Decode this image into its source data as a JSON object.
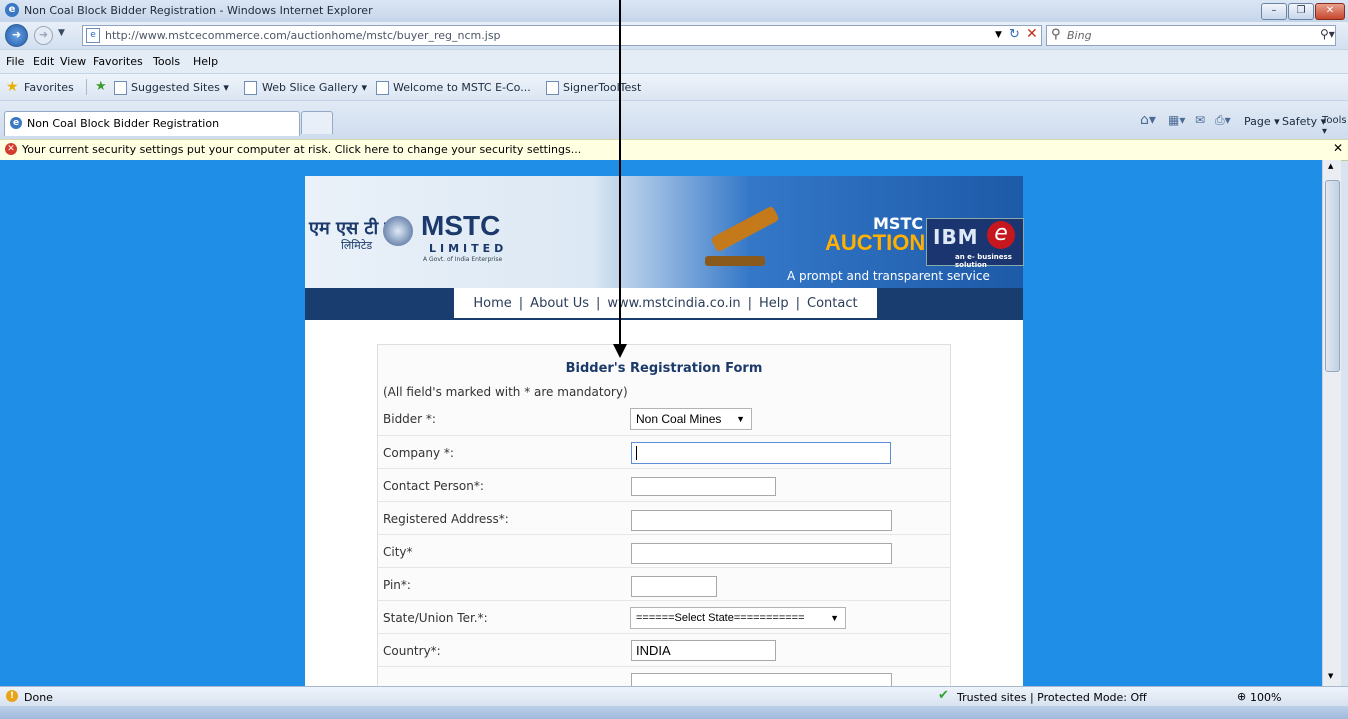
{
  "window": {
    "title": "Non Coal Block Bidder Registration - Windows Internet Explorer"
  },
  "address": {
    "url": "http://www.mstcecommerce.com/auctionhome/mstc/buyer_reg_ncm.jsp",
    "search_placeholder": "Bing"
  },
  "menu": [
    "File",
    "Edit",
    "View",
    "Favorites",
    "Tools",
    "Help"
  ],
  "favorites": {
    "label": "Favorites",
    "items": [
      "Suggested Sites ▾",
      "Web Slice Gallery ▾",
      "Welcome to MSTC E-Co...",
      "SignerToolTest"
    ]
  },
  "tab": {
    "title": "Non Coal Block Bidder Registration"
  },
  "commandbar": [
    "Page ▾",
    "Safety ▾",
    "Tools ▾"
  ],
  "infobar": {
    "text": "Your current security settings put your computer at risk. Click here to change your security settings..."
  },
  "banner": {
    "hindi": "एम एस टी सी",
    "hindi_sub": "लिमिटेड",
    "logo_title": "MSTC",
    "logo_sub": "LIMITED",
    "govt": "A Govt. of India Enterprise",
    "auction_top": "MSTC",
    "auction": "AUCTION",
    "ibm": "IBM",
    "ebiz": "an e- business solution",
    "tagline": "A prompt and transparent service"
  },
  "nav": [
    "Home",
    "About Us",
    "www.mstcindia.co.in",
    "Help",
    "Contact"
  ],
  "form": {
    "title": "Bidder's Registration Form",
    "note": "(All field's marked with * are mandatory)",
    "fields": [
      {
        "label": "Bidder *:",
        "value": "Non Coal Mines"
      },
      {
        "label": "Company *:",
        "value": ""
      },
      {
        "label": "Contact Person*:",
        "value": ""
      },
      {
        "label": "Registered Address*:",
        "value": ""
      },
      {
        "label": "City*",
        "value": ""
      },
      {
        "label": "Pin*:",
        "value": ""
      },
      {
        "label": "State/Union Ter.*:",
        "value": "======Select State==========="
      },
      {
        "label": "Country*:",
        "value": "INDIA"
      }
    ]
  },
  "status": {
    "left": "Done",
    "zone": "Trusted sites | Protected Mode: Off",
    "zoom": "100%"
  },
  "colors": {
    "page_bg": "#1f8ee6",
    "nav_bg": "#1a3d70",
    "form_title": "#1b3a6b"
  }
}
